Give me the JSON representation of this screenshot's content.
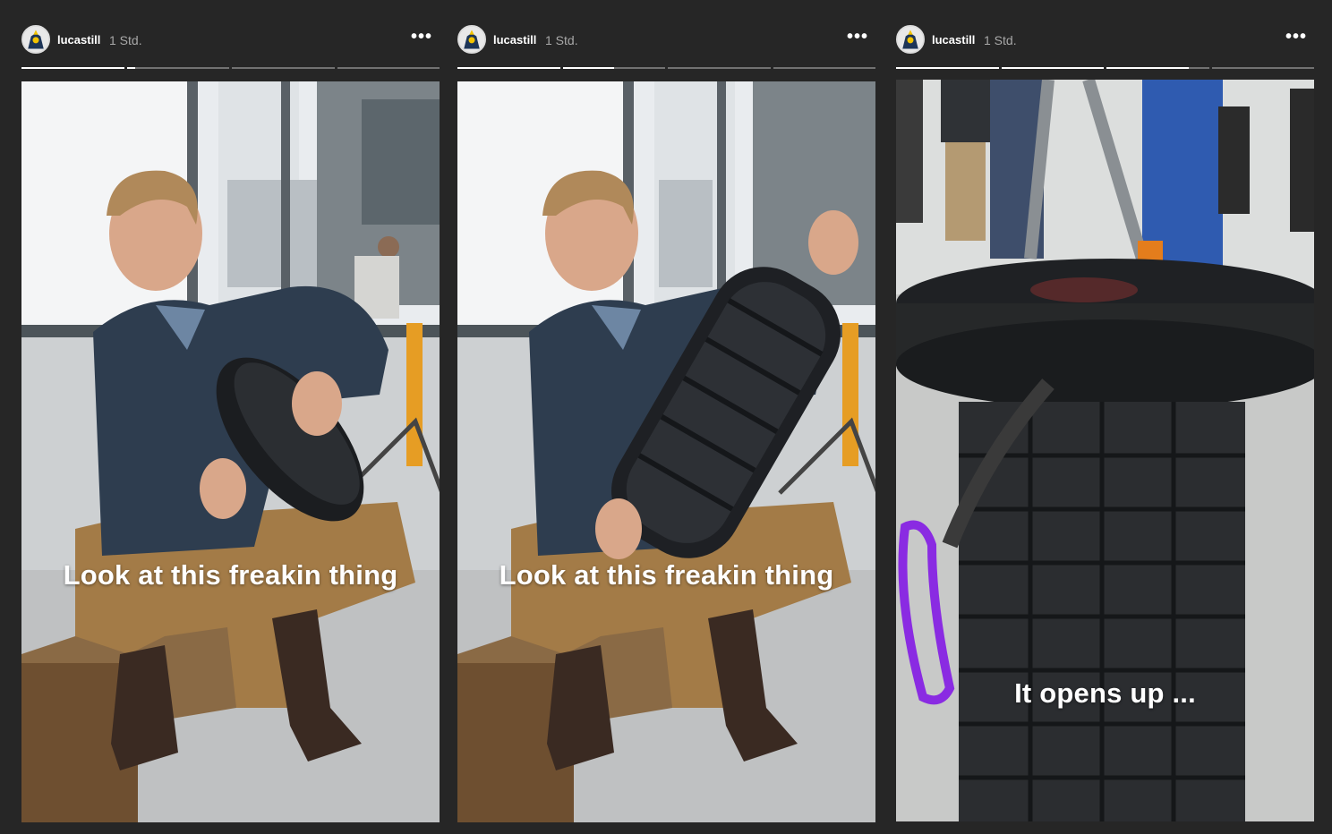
{
  "stories": [
    {
      "username": "lucastill",
      "time": "1 Std.",
      "more_icon": "more-horizontal-icon",
      "caption": "Look at this freakin thing",
      "progress": [
        1,
        0.08,
        0,
        0
      ]
    },
    {
      "username": "lucastill",
      "time": "1 Std.",
      "more_icon": "more-horizontal-icon",
      "caption": "Look at this freakin thing",
      "progress": [
        1,
        0.5,
        0,
        0
      ]
    },
    {
      "username": "lucastill",
      "time": "1 Std.",
      "more_icon": "more-horizontal-icon",
      "caption": "It opens up ...",
      "progress": [
        1,
        1,
        0.8,
        0
      ]
    }
  ],
  "colors": {
    "background": "#262626",
    "progress_track": "rgba(255,255,255,0.35)",
    "progress_fill": "#ffffff",
    "accent_purple": "#8a2be2"
  }
}
